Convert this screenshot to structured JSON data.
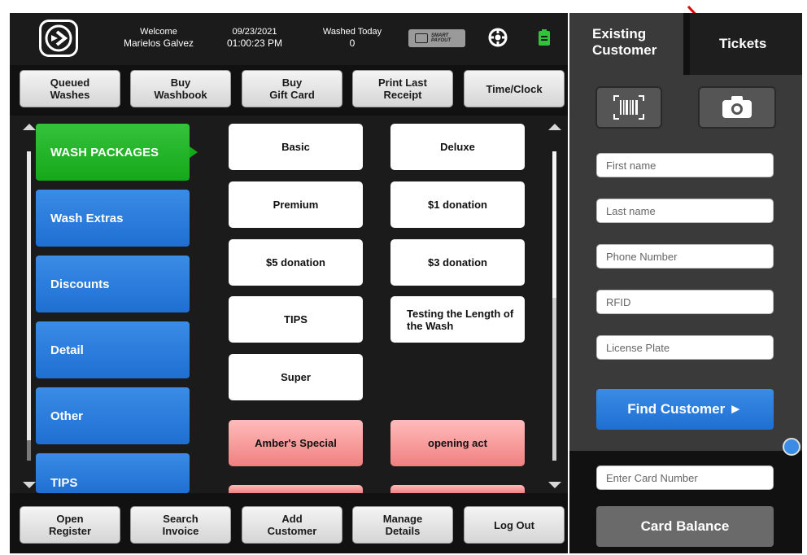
{
  "header": {
    "welcome_label": "Welcome",
    "user_name": "Marielos Galvez",
    "date": "09/23/2021",
    "time": "01:00:23 PM",
    "washed_today_label": "Washed Today",
    "washed_today_count": "0",
    "smart_payout": "SMART PAYOUT"
  },
  "top_buttons": {
    "queued_washes": "Queued\nWashes",
    "buy_washbook": "Buy\nWashbook",
    "buy_gift_card": "Buy\nGift Card",
    "print_last_receipt": "Print Last\nReceipt",
    "time_clock": "Time/Clock"
  },
  "categories": [
    "WASH PACKAGES",
    "Wash Extras",
    "Discounts",
    "Detail",
    "Other",
    "TIPS"
  ],
  "packages": [
    "Basic",
    "Deluxe",
    "Premium",
    "$1 donation",
    "$5 donation",
    "$3 donation",
    "TIPS",
    "Testing the Length of the Wash",
    "Super",
    "Amber's Special",
    "opening act"
  ],
  "bottom_buttons": {
    "open_register": "Open\nRegister",
    "search_invoice": "Search\nInvoice",
    "add_customer": "Add\nCustomer",
    "manage_details": "Manage\nDetails",
    "log_out": "Log Out"
  },
  "right_panel": {
    "tab_existing": "Existing Customer",
    "tab_tickets": "Tickets",
    "fields": {
      "first_name": "First name",
      "last_name": "Last name",
      "phone": "Phone Number",
      "rfid": "RFID",
      "license_plate": "License Plate",
      "card_number": "Enter Card Number"
    },
    "find_customer": "Find Customer ►",
    "card_balance": "Card Balance"
  },
  "colors": {
    "accent_blue": "#1f6fd2",
    "accent_green": "#16a81b",
    "pink": "#f08080",
    "annotation_arrow": "#e00000"
  }
}
